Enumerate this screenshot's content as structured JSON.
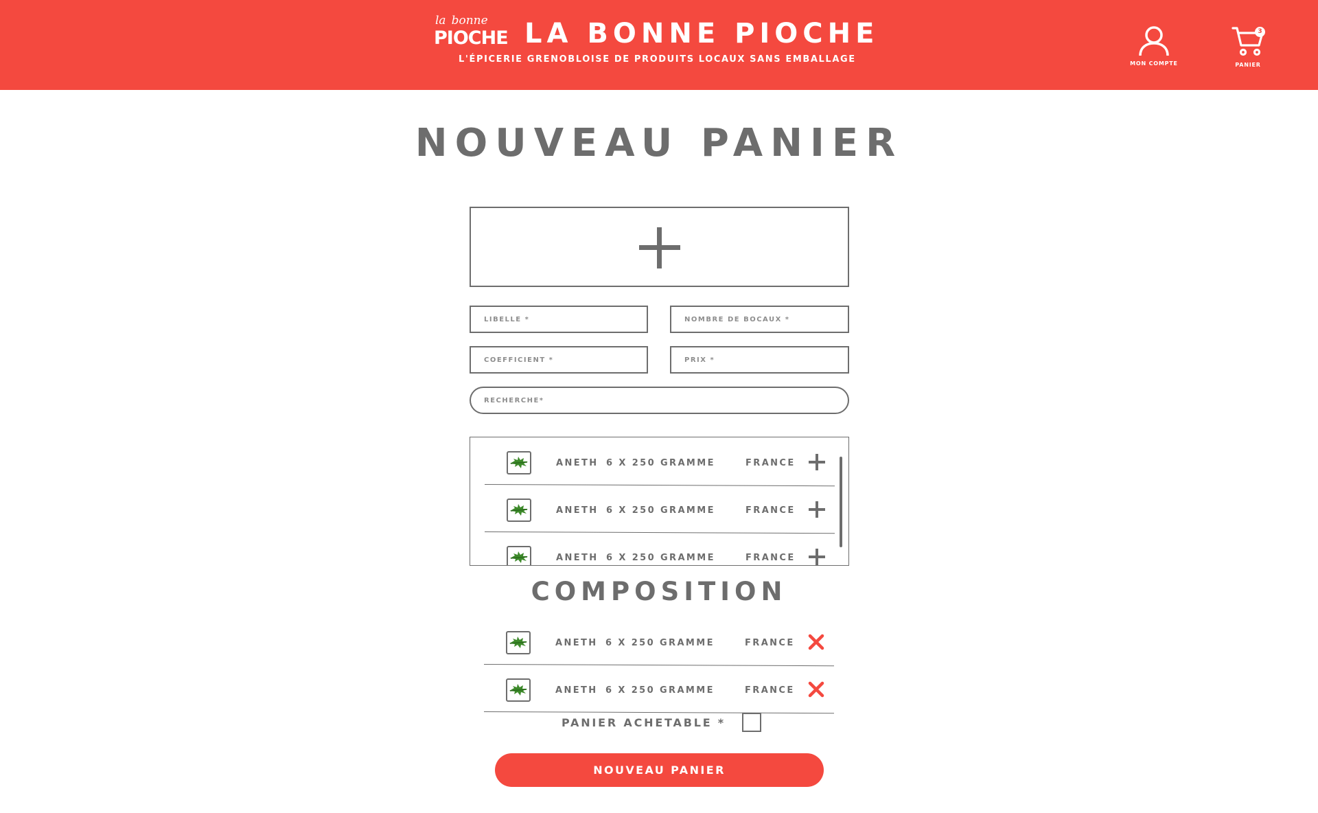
{
  "header": {
    "logo_script_1": "la",
    "logo_script_2": "bonne",
    "logo_text": "PIOCHE",
    "title": "LA BONNE PIOCHE",
    "tagline": "L'ÉPICERIE GRENOBLOISE DE PRODUITS LOCAUX SANS EMBALLAGE",
    "account_label": "MON COMPTE",
    "cart_label": "PANIER",
    "cart_count": "3"
  },
  "page": {
    "title": "NOUVEAU PANIER"
  },
  "form": {
    "libelle_placeholder": "LIBELLE *",
    "bocaux_placeholder": "NOMBRE DE BOCAUX *",
    "coefficient_placeholder": "COEFFICIENT *",
    "prix_placeholder": "PRIX *",
    "search_placeholder": "RECHERCHE*"
  },
  "products": [
    {
      "name": "ANETH",
      "quantity": "6 X 250 GRAMME",
      "origin": "FRANCE"
    },
    {
      "name": "ANETH",
      "quantity": "6 X 250 GRAMME",
      "origin": "FRANCE"
    },
    {
      "name": "ANETH",
      "quantity": "6 X 250 GRAMME",
      "origin": "FRANCE"
    }
  ],
  "composition": {
    "title": "COMPOSITION",
    "items": [
      {
        "name": "ANETH",
        "quantity": "6 X 250 GRAMME",
        "origin": "FRANCE"
      },
      {
        "name": "ANETH",
        "quantity": "6 X 250 GRAMME",
        "origin": "FRANCE"
      }
    ]
  },
  "achetable_label": "PANIER ACHETABLE *",
  "submit_label": "NOUVEAU PANIER",
  "colors": {
    "brand": "#f4493f",
    "text": "#6d6d6d",
    "remove": "#f4493f"
  },
  "icons": {
    "account": "user-icon",
    "cart": "cart-icon",
    "add": "plus-icon",
    "remove": "close-icon",
    "product": "dill-icon"
  }
}
